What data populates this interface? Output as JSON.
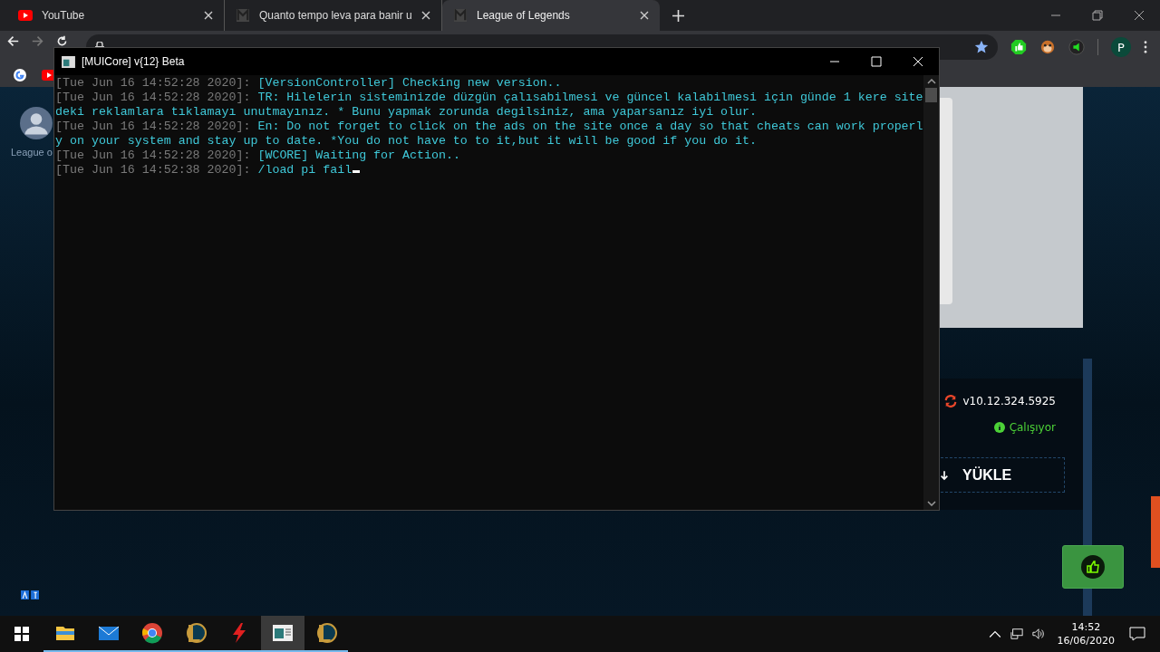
{
  "browser": {
    "tabs": [
      {
        "title": "YouTube",
        "kind": "youtube",
        "selected": false
      },
      {
        "title": "Quanto tempo leva para banir u",
        "kind": "m",
        "selected": false
      },
      {
        "title": "League of Legends",
        "kind": "m",
        "selected": true
      }
    ],
    "profile": "P"
  },
  "page": {
    "sidebar_label": "League o",
    "version": "v10.12.324.5925",
    "status": "Çalışıyor",
    "load_button": "YÜKLE"
  },
  "console": {
    "title": "[MUICore] v{12} Beta",
    "lines": [
      {
        "time": "[Tue Jun 16 14:52:28 2020]: ",
        "message": "[VersionController] Checking new version.."
      },
      {
        "time": "[Tue Jun 16 14:52:28 2020]: ",
        "message": "TR: Hilelerin sisteminizde düzgün çalısabilmesi ve güncel kalabilmesi için günde 1 kere sitedeki reklamlara tıklamayı unutmayınız. * Bunu yapmak zorunda degilsiniz, ama yaparsanız iyi olur."
      },
      {
        "time": "[Tue Jun 16 14:52:28 2020]: ",
        "message": "En: Do not forget to click on the ads on the site once a day so that cheats can work properly on your system and stay up to date. *You do not have to to it,but it will be good if you do it."
      },
      {
        "time": "[Tue Jun 16 14:52:28 2020]: ",
        "message": "[WCORE] Waiting for Action.."
      },
      {
        "time": "[Tue Jun 16 14:52:38 2020]: ",
        "message": "/load pi fail"
      }
    ]
  },
  "taskbar": {
    "apps": [
      {
        "kind": "folder",
        "active": false
      },
      {
        "kind": "mail",
        "active": false
      },
      {
        "kind": "chrome",
        "active": false
      },
      {
        "kind": "league",
        "active": false
      },
      {
        "kind": "bolt",
        "active": false
      },
      {
        "kind": "console",
        "active": true
      },
      {
        "kind": "league",
        "active": false
      }
    ],
    "time": "14:52",
    "date": "16/06/2020"
  }
}
